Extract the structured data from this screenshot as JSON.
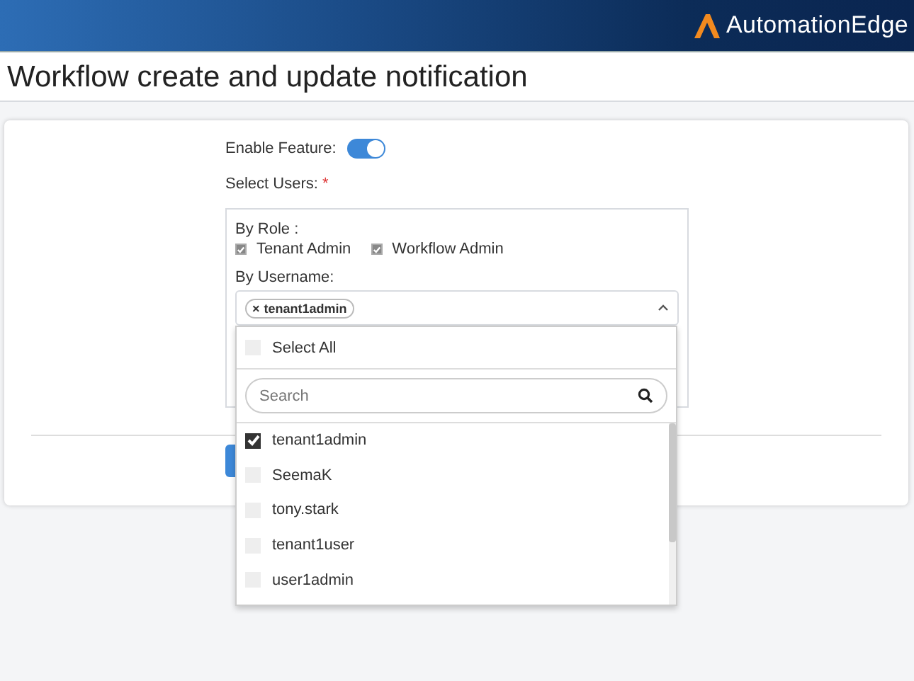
{
  "header": {
    "logo_text": "AutomationEdge"
  },
  "page_title": "Workflow create and update notification",
  "form": {
    "enable_feature": {
      "label": "Enable Feature:",
      "on": true
    },
    "select_users": {
      "label": "Select Users:",
      "required_mark": "*"
    },
    "by_role": {
      "label": "By Role :",
      "roles": [
        {
          "label": "Tenant Admin",
          "checked": true
        },
        {
          "label": "Workflow Admin",
          "checked": true
        }
      ]
    },
    "by_username": {
      "label": "By Username:",
      "tags": [
        {
          "remove": "×",
          "label": "tenant1admin"
        }
      ]
    },
    "dropdown": {
      "select_all": {
        "label": "Select All",
        "checked": false
      },
      "search": {
        "placeholder": "Search"
      },
      "options": [
        {
          "label": "tenant1admin",
          "checked": true
        },
        {
          "label": "SeemaK",
          "checked": false
        },
        {
          "label": "tony.stark",
          "checked": false
        },
        {
          "label": "tenant1user",
          "checked": false
        },
        {
          "label": "user1admin",
          "checked": false
        }
      ]
    }
  }
}
